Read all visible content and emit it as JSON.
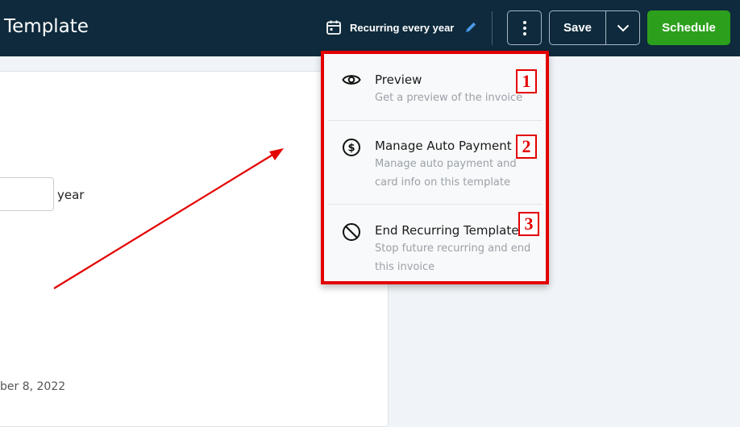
{
  "header": {
    "title": "Template",
    "recurring_label": "Recurring every year",
    "save_label": "Save",
    "schedule_label": "Schedule"
  },
  "form": {
    "year_label": "year",
    "date_fragment": "ber 8, 2022"
  },
  "menu": {
    "items": [
      {
        "label": "Preview",
        "description": "Get a preview of the invoice",
        "icon": "eye-icon",
        "badge": "1"
      },
      {
        "label": "Manage Auto Payment",
        "description": "Manage auto payment and card info on this template",
        "icon": "dollar-circle-icon",
        "badge": "2"
      },
      {
        "label": "End Recurring Template",
        "description": "Stop future recurring and end this invoice",
        "icon": "ban-icon",
        "badge": "3"
      }
    ]
  },
  "colors": {
    "header_bg": "#0e2a3c",
    "schedule_green": "#2ca01c",
    "annotation_red": "#e30000",
    "pencil_blue": "#4a9be8"
  }
}
